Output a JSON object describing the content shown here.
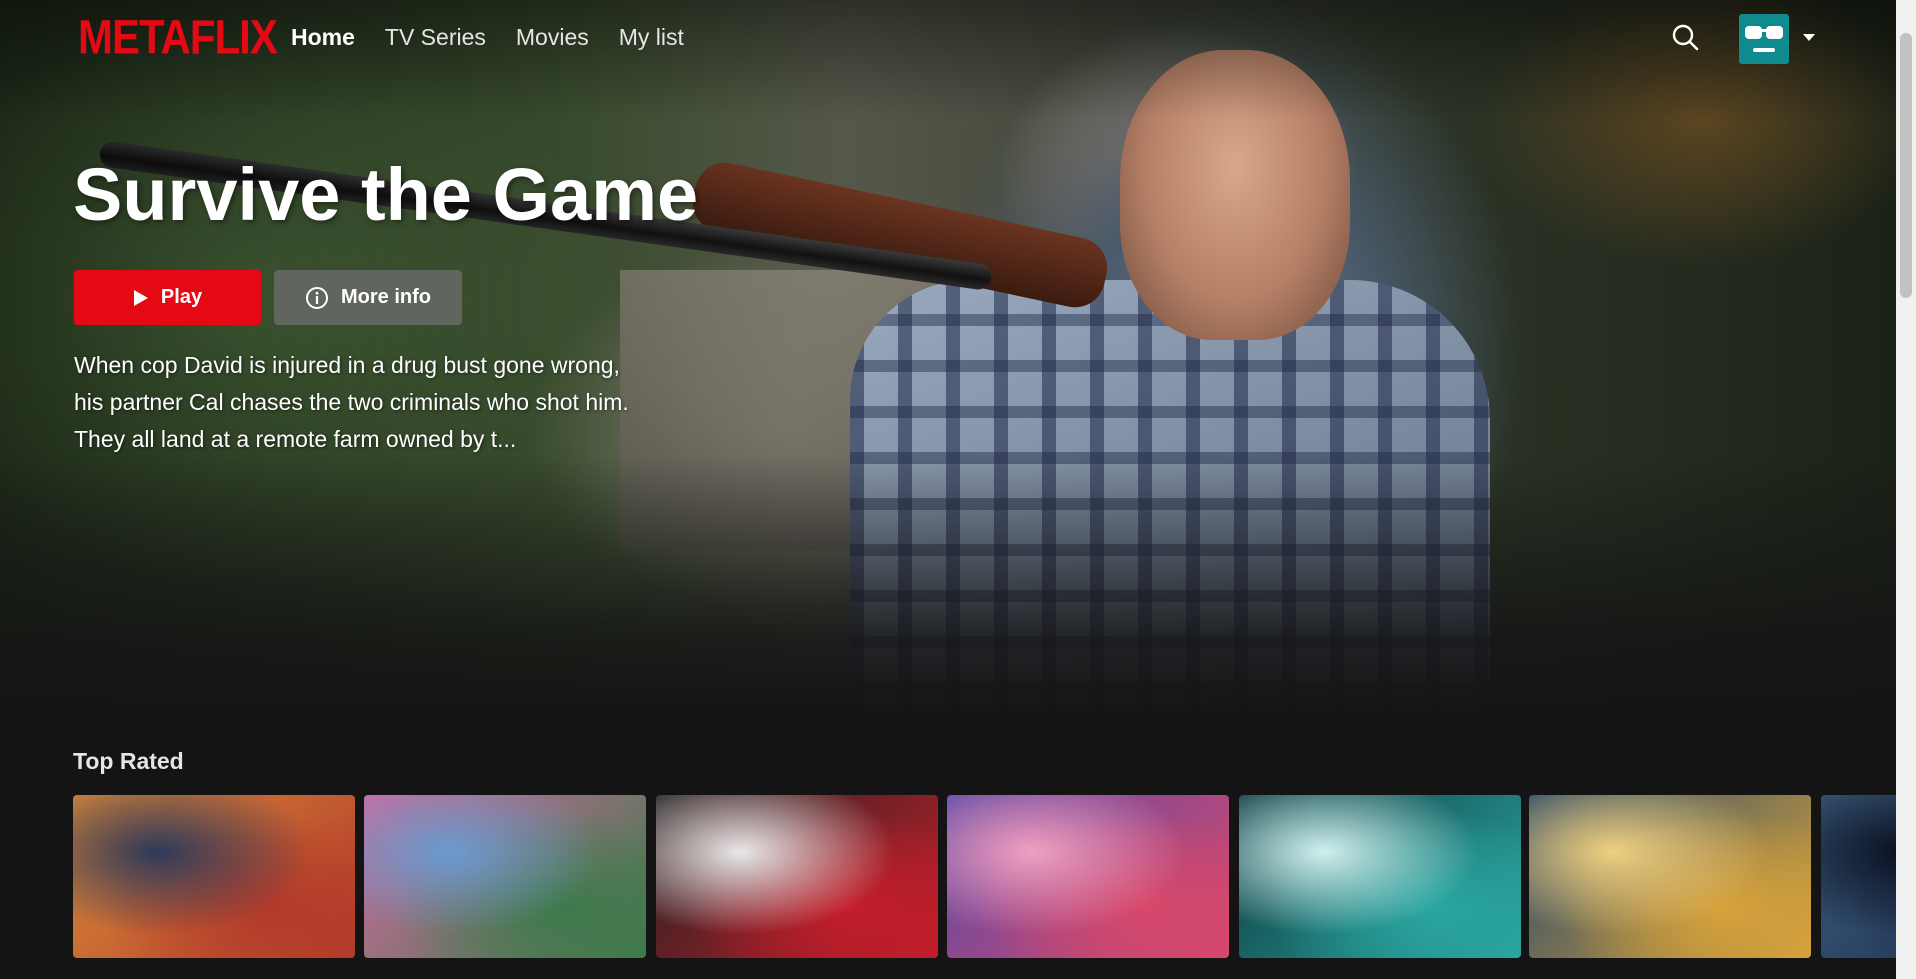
{
  "app": {
    "logo": "METAFLIX"
  },
  "nav": {
    "links": [
      {
        "label": "Home",
        "active": true
      },
      {
        "label": "TV Series",
        "active": false
      },
      {
        "label": "Movies",
        "active": false
      },
      {
        "label": "My list",
        "active": false
      }
    ]
  },
  "header": {
    "search_icon": "search-icon",
    "avatar_icon": "sunglasses-avatar",
    "menu_icon": "caret-down-icon"
  },
  "hero": {
    "title": "Survive the Game",
    "play_label": "Play",
    "info_label": "More info",
    "description": "When cop David is injured in a drug bust gone wrong, his partner Cal chases the two criminals who shot him. They all land at a remote farm owned by t..."
  },
  "rows": [
    {
      "title": "Top Rated",
      "cards": [
        {
          "colors": [
            "#b23a2a",
            "#d98b3a",
            "#2d3a5a"
          ]
        },
        {
          "colors": [
            "#3d7a4a",
            "#d26aa0",
            "#6a9ad0"
          ]
        },
        {
          "colors": [
            "#c41e2a",
            "#222222",
            "#e8e8e8"
          ]
        },
        {
          "colors": [
            "#d8486a",
            "#5a4aa8",
            "#f0a0c0"
          ]
        },
        {
          "colors": [
            "#2aa6a0",
            "#0f3a40",
            "#d0f0ee"
          ]
        },
        {
          "colors": [
            "#d7a23a",
            "#2a4a6a",
            "#f0d080"
          ]
        },
        {
          "colors": [
            "#1a2a4a",
            "#3a5a7a",
            "#0a1020"
          ]
        }
      ]
    }
  ],
  "colors": {
    "brand": "#e50914",
    "background": "#141414",
    "avatar_bg": "#0f8a8f"
  }
}
